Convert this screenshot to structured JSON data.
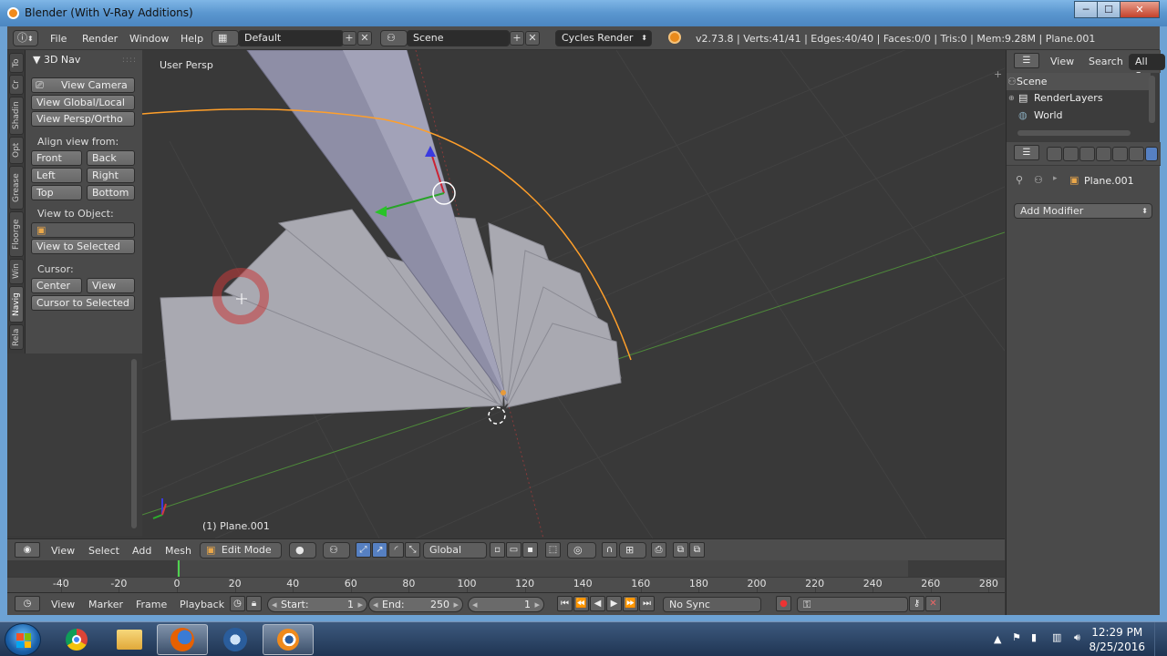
{
  "window": {
    "title": "Blender (With V-Ray Additions)",
    "min_label": "─",
    "max_label": "☐",
    "close_label": "✕"
  },
  "infobar": {
    "menus": [
      "File",
      "Render",
      "Window",
      "Help"
    ],
    "screen_layout": "Default",
    "scene": "Scene",
    "render_engine": "Cycles Render",
    "stats": "v2.73.8 | Verts:41/41 | Edges:40/40 | Faces:0/0 | Tris:0 | Mem:9.28M | Plane.001",
    "add_label": "+",
    "remove_label": "✕",
    "dropdown_arrows": "⬍"
  },
  "toolshelf": {
    "tabs": [
      "To",
      "Cr",
      "Shadin",
      "Opt",
      "Grease",
      "Floorge",
      "Win",
      "Navig",
      "Rela"
    ],
    "panel_title": "▼ 3D Nav",
    "grip": "::::",
    "view_camera": "View Camera",
    "view_global_local": "View Global/Local",
    "view_persp_ortho": "View Persp/Ortho",
    "align_label": "Align view from:",
    "front": "Front",
    "back": "Back",
    "left": "Left",
    "right": "Right",
    "top": "Top",
    "bottom": "Bottom",
    "view_to_object_label": "View to Object:",
    "view_to_selected": "View to Selected",
    "cursor_label": "Cursor:",
    "center": "Center",
    "view": "View",
    "cursor_to_selected": "Cursor to Selected"
  },
  "viewport": {
    "view_name": "User Persp",
    "object_name": "(1) Plane.001"
  },
  "view_header": {
    "menus": [
      "View",
      "Select",
      "Add",
      "Mesh"
    ],
    "mode": "Edit Mode",
    "orientation": "Global"
  },
  "timeline": {
    "ticks": [
      -40,
      -20,
      0,
      20,
      40,
      60,
      80,
      100,
      120,
      140,
      160,
      180,
      200,
      220,
      240,
      260,
      280
    ],
    "current_frame": 1
  },
  "timeline_header": {
    "menus": [
      "View",
      "Marker",
      "Frame",
      "Playback"
    ],
    "start_label": "Start:",
    "start_value": "1",
    "end_label": "End:",
    "end_value": "250",
    "current_value": "1",
    "sync": "No Sync",
    "arrow_left": "◂",
    "arrow_right": "▸"
  },
  "outliner": {
    "view": "View",
    "search": "Search",
    "filter": "All Sc",
    "items": [
      "Scene",
      "RenderLayers",
      "World"
    ]
  },
  "properties": {
    "object": "Plane.001",
    "add_modifier": "Add Modifier"
  },
  "taskbar": {
    "time": "12:29 PM",
    "date": "8/25/2016"
  }
}
